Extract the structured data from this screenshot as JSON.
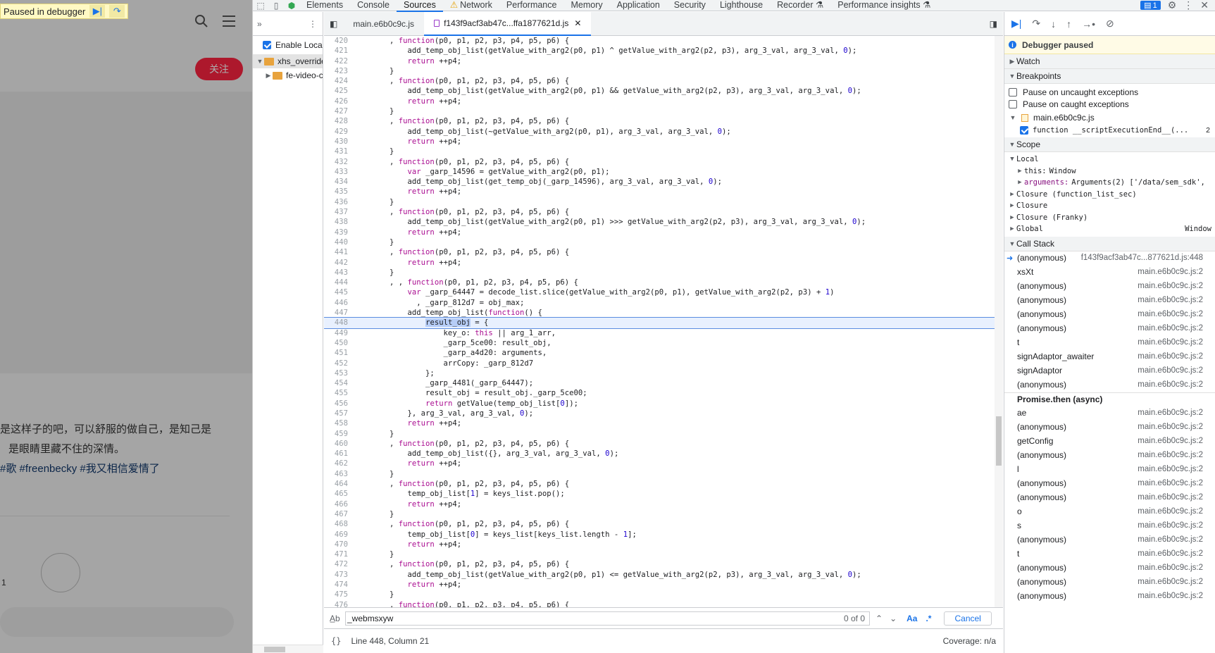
{
  "page": {
    "paused_banner": "Paused in debugger",
    "follow_label": "关注",
    "text_line_1": "是这样子的吧，可以舒服的做自己，是知己是",
    "text_line_2": "是眼睛里藏不住的深情。",
    "text_tags": "#歌 #freenbecky #我又相信爱情了",
    "count": "1"
  },
  "devtools": {
    "tabs": [
      "Elements",
      "Console",
      "Sources",
      "Network",
      "Performance",
      "Memory",
      "Application",
      "Security",
      "Lighthouse",
      "Recorder",
      "Performance insights"
    ],
    "active_tab": "Sources",
    "issues_count": "1"
  },
  "navigator": {
    "enable_local": "Enable Local",
    "tree": [
      {
        "label": "xhs_override",
        "expanded": true,
        "level": 0
      },
      {
        "label": "fe-video-c",
        "expanded": false,
        "level": 1
      }
    ]
  },
  "editor": {
    "tabs": [
      {
        "label": "main.e6b0c9c.js",
        "active": false
      },
      {
        "label": "f143f9acf3ab47c...ffa1877621d.js",
        "active": true
      }
    ],
    "current_line": 448,
    "lines": [
      {
        "n": "420",
        "t": "        , function(p0, p1, p2, p3, p4, p5, p6) {"
      },
      {
        "n": "421",
        "t": "            add_temp_obj_list(getValue_with_arg2(p0, p1) ^ getValue_with_arg2(p2, p3), arg_3_val, arg_3_val, 0);"
      },
      {
        "n": "422",
        "t": "            return ++p4;"
      },
      {
        "n": "423",
        "t": "        }"
      },
      {
        "n": "424",
        "t": "        , function(p0, p1, p2, p3, p4, p5, p6) {"
      },
      {
        "n": "425",
        "t": "            add_temp_obj_list(getValue_with_arg2(p0, p1) && getValue_with_arg2(p2, p3), arg_3_val, arg_3_val, 0);"
      },
      {
        "n": "426",
        "t": "            return ++p4;"
      },
      {
        "n": "427",
        "t": "        }"
      },
      {
        "n": "428",
        "t": "        , function(p0, p1, p2, p3, p4, p5, p6) {"
      },
      {
        "n": "429",
        "t": "            add_temp_obj_list(~getValue_with_arg2(p0, p1), arg_3_val, arg_3_val, 0);"
      },
      {
        "n": "430",
        "t": "            return ++p4;"
      },
      {
        "n": "431",
        "t": "        }"
      },
      {
        "n": "432",
        "t": "        , function(p0, p1, p2, p3, p4, p5, p6) {"
      },
      {
        "n": "433",
        "t": "            var _garp_14596 = getValue_with_arg2(p0, p1);"
      },
      {
        "n": "434",
        "t": "            add_temp_obj_list(get_temp_obj(_garp_14596), arg_3_val, arg_3_val, 0);"
      },
      {
        "n": "435",
        "t": "            return ++p4;"
      },
      {
        "n": "436",
        "t": "        }"
      },
      {
        "n": "437",
        "t": "        , function(p0, p1, p2, p3, p4, p5, p6) {"
      },
      {
        "n": "438",
        "t": "            add_temp_obj_list(getValue_with_arg2(p0, p1) >>> getValue_with_arg2(p2, p3), arg_3_val, arg_3_val, 0);"
      },
      {
        "n": "439",
        "t": "            return ++p4;"
      },
      {
        "n": "440",
        "t": "        }"
      },
      {
        "n": "441",
        "t": "        , function(p0, p1, p2, p3, p4, p5, p6) {"
      },
      {
        "n": "442",
        "t": "            return ++p4;"
      },
      {
        "n": "443",
        "t": "        }"
      },
      {
        "n": "444",
        "t": "        , , function(p0, p1, p2, p3, p4, p5, p6) {"
      },
      {
        "n": "445",
        "t": "            var _garp_64447 = decode_list.slice(getValue_with_arg2(p0, p1), getValue_with_arg2(p2, p3) + 1)"
      },
      {
        "n": "446",
        "t": "              , _garp_812d7 = obj_max;"
      },
      {
        "n": "447",
        "t": "            add_temp_obj_list(function() {"
      },
      {
        "n": "448",
        "t": "                result_obj = {",
        "hl": "result_obj"
      },
      {
        "n": "449",
        "t": "                    key_o: this || arg_1_arr,"
      },
      {
        "n": "450",
        "t": "                    _garp_5ce00: result_obj,"
      },
      {
        "n": "451",
        "t": "                    _garp_a4d20: arguments,"
      },
      {
        "n": "452",
        "t": "                    arrCopy: _garp_812d7"
      },
      {
        "n": "453",
        "t": "                };"
      },
      {
        "n": "454",
        "t": "                _garp_4481(_garp_64447);"
      },
      {
        "n": "455",
        "t": "                result_obj = result_obj._garp_5ce00;"
      },
      {
        "n": "456",
        "t": "                return getValue(temp_obj_list[0]);"
      },
      {
        "n": "457",
        "t": "            }, arg_3_val, arg_3_val, 0);"
      },
      {
        "n": "458",
        "t": "            return ++p4;"
      },
      {
        "n": "459",
        "t": "        }"
      },
      {
        "n": "460",
        "t": "        , function(p0, p1, p2, p3, p4, p5, p6) {"
      },
      {
        "n": "461",
        "t": "            add_temp_obj_list({}, arg_3_val, arg_3_val, 0);"
      },
      {
        "n": "462",
        "t": "            return ++p4;"
      },
      {
        "n": "463",
        "t": "        }"
      },
      {
        "n": "464",
        "t": "        , function(p0, p1, p2, p3, p4, p5, p6) {"
      },
      {
        "n": "465",
        "t": "            temp_obj_list[1] = keys_list.pop();"
      },
      {
        "n": "466",
        "t": "            return ++p4;"
      },
      {
        "n": "467",
        "t": "        }"
      },
      {
        "n": "468",
        "t": "        , function(p0, p1, p2, p3, p4, p5, p6) {"
      },
      {
        "n": "469",
        "t": "            temp_obj_list[0] = keys_list[keys_list.length - 1];"
      },
      {
        "n": "470",
        "t": "            return ++p4;"
      },
      {
        "n": "471",
        "t": "        }"
      },
      {
        "n": "472",
        "t": "        , function(p0, p1, p2, p3, p4, p5, p6) {"
      },
      {
        "n": "473",
        "t": "            add_temp_obj_list(getValue_with_arg2(p0, p1) <= getValue_with_arg2(p2, p3), arg_3_val, arg_3_val, 0);"
      },
      {
        "n": "474",
        "t": "            return ++p4;"
      },
      {
        "n": "475",
        "t": "        }"
      },
      {
        "n": "476",
        "t": "        , function(p0, p1, p2, p3, p4, p5, p6) {"
      }
    ],
    "search_value": "_webmsxyw",
    "search_count": "0 of 0",
    "case_label": "Aa",
    "regex_label": ".*",
    "cancel_label": "Cancel",
    "status_position": "Line 448, Column 21",
    "status_braces": "{}",
    "coverage": "Coverage: n/a"
  },
  "debugger": {
    "paused_label": "Debugger paused",
    "watch_label": "Watch",
    "breakpoints_label": "Breakpoints",
    "pause_uncaught": "Pause on uncaught exceptions",
    "pause_caught": "Pause on caught exceptions",
    "bp_file": "main.e6b0c9c.js",
    "bp_fn": "function __scriptExecutionEnd__(...",
    "bp_count": "2",
    "scope_label": "Scope",
    "scope_local": "Local",
    "scope_this_key": "this:",
    "scope_this_val": "Window",
    "scope_args_key": "arguments:",
    "scope_args_val": "Arguments(2) ['/data/sem_sdk',",
    "scope_closure_1": "Closure (function_list_sec)",
    "scope_closure_2": "Closure",
    "scope_closure_3": "Closure (Franky)",
    "scope_global": "Global",
    "scope_global_val": "Window",
    "callstack_label": "Call Stack",
    "stack": [
      {
        "name": "(anonymous)",
        "loc": "f143f9acf3ab47c...877621d.js:448",
        "current": true
      },
      {
        "name": "xsXt",
        "loc": "main.e6b0c9c.js:2"
      },
      {
        "name": "(anonymous)",
        "loc": "main.e6b0c9c.js:2"
      },
      {
        "name": "(anonymous)",
        "loc": "main.e6b0c9c.js:2"
      },
      {
        "name": "(anonymous)",
        "loc": "main.e6b0c9c.js:2"
      },
      {
        "name": "(anonymous)",
        "loc": "main.e6b0c9c.js:2"
      },
      {
        "name": "t",
        "loc": "main.e6b0c9c.js:2"
      },
      {
        "name": "signAdaptor_awaiter",
        "loc": "main.e6b0c9c.js:2"
      },
      {
        "name": "signAdaptor",
        "loc": "main.e6b0c9c.js:2"
      },
      {
        "name": "(anonymous)",
        "loc": "main.e6b0c9c.js:2"
      },
      {
        "name": "Promise.then (async)",
        "loc": "",
        "async": true
      },
      {
        "name": "ae",
        "loc": "main.e6b0c9c.js:2"
      },
      {
        "name": "(anonymous)",
        "loc": "main.e6b0c9c.js:2"
      },
      {
        "name": "getConfig",
        "loc": "main.e6b0c9c.js:2"
      },
      {
        "name": "(anonymous)",
        "loc": "main.e6b0c9c.js:2"
      },
      {
        "name": "l",
        "loc": "main.e6b0c9c.js:2"
      },
      {
        "name": "(anonymous)",
        "loc": "main.e6b0c9c.js:2"
      },
      {
        "name": "(anonymous)",
        "loc": "main.e6b0c9c.js:2"
      },
      {
        "name": "o",
        "loc": "main.e6b0c9c.js:2"
      },
      {
        "name": "s",
        "loc": "main.e6b0c9c.js:2"
      },
      {
        "name": "(anonymous)",
        "loc": "main.e6b0c9c.js:2"
      },
      {
        "name": "t",
        "loc": "main.e6b0c9c.js:2"
      },
      {
        "name": "(anonymous)",
        "loc": "main.e6b0c9c.js:2"
      },
      {
        "name": "(anonymous)",
        "loc": "main.e6b0c9c.js:2"
      },
      {
        "name": "(anonymous)",
        "loc": "main.e6b0c9c.js:2"
      }
    ]
  }
}
